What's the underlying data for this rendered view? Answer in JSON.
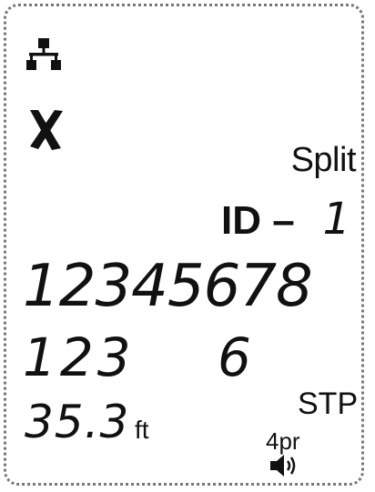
{
  "display": {
    "split_label": "Split",
    "id_label": "ID –",
    "id_value": "1",
    "wire_map_top": "12345678",
    "wire_map_bottom": "123",
    "wire_map_extra": "6",
    "length_value": "35.3",
    "length_unit": "ft",
    "cable_type": "STP",
    "pair_mode": "4pr"
  },
  "icons": {
    "network": "network-icon",
    "fail": "fail-x-icon",
    "speaker": "speaker-icon"
  },
  "colors": {
    "segment": "#111111",
    "border": "#777777",
    "background": "#ffffff"
  }
}
